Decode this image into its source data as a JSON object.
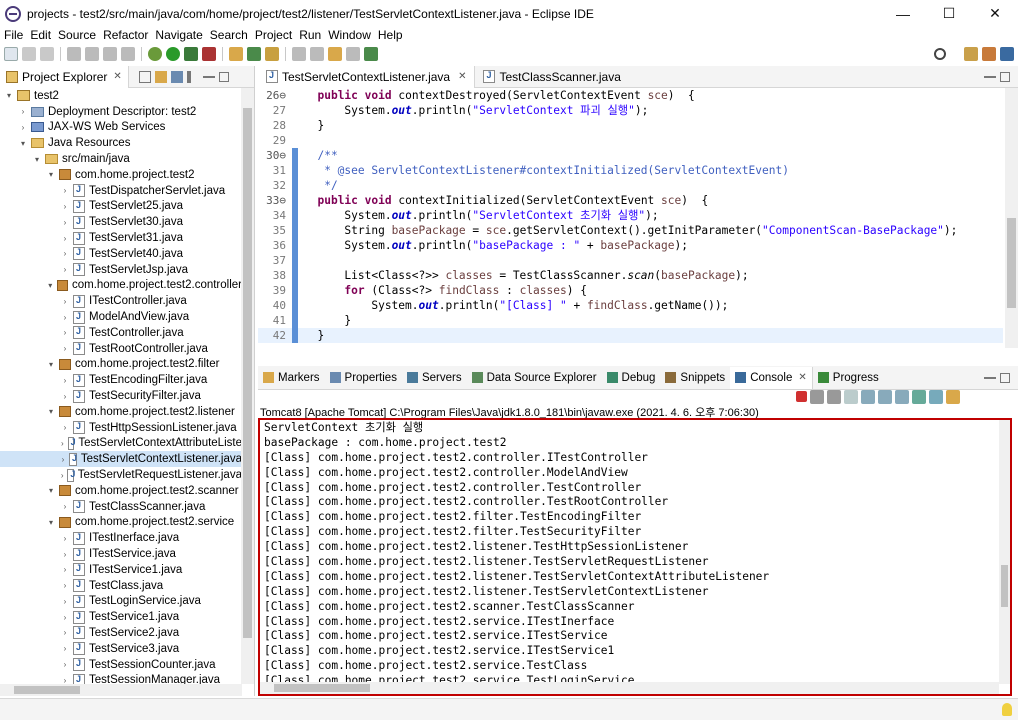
{
  "window": {
    "title": "projects - test2/src/main/java/com/home/project/test2/listener/TestServletContextListener.java - Eclipse IDE",
    "minimize": "—",
    "maximize": "☐",
    "close": "✕"
  },
  "menu": [
    "File",
    "Edit",
    "Source",
    "Refactor",
    "Navigate",
    "Search",
    "Project",
    "Run",
    "Window",
    "Help"
  ],
  "explorer": {
    "tab_label": "Project Explorer",
    "tree": [
      {
        "label": "test2",
        "depth": 0,
        "type": "project",
        "open": true
      },
      {
        "label": "Deployment Descriptor: test2",
        "depth": 1,
        "type": "dd",
        "open": false
      },
      {
        "label": "JAX-WS Web Services",
        "depth": 1,
        "type": "ws",
        "open": false
      },
      {
        "label": "Java Resources",
        "depth": 1,
        "type": "folder",
        "open": true
      },
      {
        "label": "src/main/java",
        "depth": 2,
        "type": "folder",
        "open": true
      },
      {
        "label": "com.home.project.test2",
        "depth": 3,
        "type": "pkg",
        "open": true
      },
      {
        "label": "TestDispatcherServlet.java",
        "depth": 4,
        "type": "java"
      },
      {
        "label": "TestServlet25.java",
        "depth": 4,
        "type": "java"
      },
      {
        "label": "TestServlet30.java",
        "depth": 4,
        "type": "java"
      },
      {
        "label": "TestServlet31.java",
        "depth": 4,
        "type": "java"
      },
      {
        "label": "TestServlet40.java",
        "depth": 4,
        "type": "java"
      },
      {
        "label": "TestServletJsp.java",
        "depth": 4,
        "type": "java"
      },
      {
        "label": "com.home.project.test2.controller",
        "depth": 3,
        "type": "pkg",
        "open": true
      },
      {
        "label": "ITestController.java",
        "depth": 4,
        "type": "java"
      },
      {
        "label": "ModelAndView.java",
        "depth": 4,
        "type": "java"
      },
      {
        "label": "TestController.java",
        "depth": 4,
        "type": "java"
      },
      {
        "label": "TestRootController.java",
        "depth": 4,
        "type": "java"
      },
      {
        "label": "com.home.project.test2.filter",
        "depth": 3,
        "type": "pkg",
        "open": true
      },
      {
        "label": "TestEncodingFilter.java",
        "depth": 4,
        "type": "java"
      },
      {
        "label": "TestSecurityFilter.java",
        "depth": 4,
        "type": "java"
      },
      {
        "label": "com.home.project.test2.listener",
        "depth": 3,
        "type": "pkg",
        "open": true
      },
      {
        "label": "TestHttpSessionListener.java",
        "depth": 4,
        "type": "java"
      },
      {
        "label": "TestServletContextAttributeListe",
        "depth": 4,
        "type": "java"
      },
      {
        "label": "TestServletContextListener.java",
        "depth": 4,
        "type": "java",
        "selected": true
      },
      {
        "label": "TestServletRequestListener.java",
        "depth": 4,
        "type": "java"
      },
      {
        "label": "com.home.project.test2.scanner",
        "depth": 3,
        "type": "pkg",
        "open": true
      },
      {
        "label": "TestClassScanner.java",
        "depth": 4,
        "type": "java"
      },
      {
        "label": "com.home.project.test2.service",
        "depth": 3,
        "type": "pkg",
        "open": true
      },
      {
        "label": "ITestInerface.java",
        "depth": 4,
        "type": "java"
      },
      {
        "label": "ITestService.java",
        "depth": 4,
        "type": "java"
      },
      {
        "label": "ITestService1.java",
        "depth": 4,
        "type": "java"
      },
      {
        "label": "TestClass.java",
        "depth": 4,
        "type": "java"
      },
      {
        "label": "TestLoginService.java",
        "depth": 4,
        "type": "java"
      },
      {
        "label": "TestService1.java",
        "depth": 4,
        "type": "java"
      },
      {
        "label": "TestService2.java",
        "depth": 4,
        "type": "java"
      },
      {
        "label": "TestService3.java",
        "depth": 4,
        "type": "java"
      },
      {
        "label": "TestSessionCounter.java",
        "depth": 4,
        "type": "java"
      },
      {
        "label": "TestSessionManager.java",
        "depth": 4,
        "type": "java"
      }
    ]
  },
  "editor": {
    "tabs": [
      {
        "label": "TestServletContextListener.java",
        "active": true
      },
      {
        "label": "TestClassScanner.java",
        "active": false
      }
    ],
    "lines": [
      {
        "n": "26",
        "mark": "⊖",
        "tokens": [
          [
            "  ",
            ""
          ],
          [
            "public",
            "kw"
          ],
          [
            " ",
            ""
          ],
          [
            "void",
            "kw"
          ],
          [
            " contextDestroyed(ServletContextEvent ",
            ""
          ],
          [
            "sce",
            "var"
          ],
          [
            ")  {",
            ""
          ]
        ]
      },
      {
        "n": "27",
        "tokens": [
          [
            "      System.",
            ""
          ],
          [
            "out",
            "fld"
          ],
          [
            ".println(",
            ""
          ],
          [
            "\"ServletContext 파괴 실행\"",
            "str"
          ],
          [
            ");",
            ""
          ]
        ]
      },
      {
        "n": "28",
        "tokens": [
          [
            "  }",
            ""
          ]
        ]
      },
      {
        "n": "29",
        "tokens": []
      },
      {
        "n": "30",
        "mark": "⊖",
        "gut": true,
        "tokens": [
          [
            "  /**",
            "cmt"
          ]
        ]
      },
      {
        "n": "31",
        "gut": true,
        "tokens": [
          [
            "   * @see ServletContextListener#contextInitialized(ServletContextEvent)",
            "cmt"
          ]
        ]
      },
      {
        "n": "32",
        "gut": true,
        "tokens": [
          [
            "   */",
            "cmt"
          ]
        ]
      },
      {
        "n": "33",
        "mark": "⊖",
        "gut": true,
        "tokens": [
          [
            "  ",
            ""
          ],
          [
            "public",
            "kw"
          ],
          [
            " ",
            ""
          ],
          [
            "void",
            "kw"
          ],
          [
            " contextInitialized(ServletContextEvent ",
            ""
          ],
          [
            "sce",
            "var"
          ],
          [
            ")  {",
            ""
          ]
        ]
      },
      {
        "n": "34",
        "gut": true,
        "tokens": [
          [
            "      System.",
            ""
          ],
          [
            "out",
            "fld"
          ],
          [
            ".println(",
            ""
          ],
          [
            "\"ServletContext 초기화 실행\"",
            "str"
          ],
          [
            ");",
            ""
          ]
        ]
      },
      {
        "n": "35",
        "gut": true,
        "tokens": [
          [
            "      String ",
            ""
          ],
          [
            "basePackage",
            "var"
          ],
          [
            " = ",
            ""
          ],
          [
            "sce",
            "var"
          ],
          [
            ".getServletContext().getInitParameter(",
            ""
          ],
          [
            "\"ComponentScan-BasePackage\"",
            "str"
          ],
          [
            ");",
            ""
          ]
        ]
      },
      {
        "n": "36",
        "gut": true,
        "tokens": [
          [
            "      System.",
            ""
          ],
          [
            "out",
            "fld"
          ],
          [
            ".println(",
            ""
          ],
          [
            "\"basePackage : \"",
            "str"
          ],
          [
            " + ",
            ""
          ],
          [
            "basePackage",
            "var"
          ],
          [
            ");",
            ""
          ]
        ]
      },
      {
        "n": "37",
        "gut": true,
        "tokens": []
      },
      {
        "n": "38",
        "gut": true,
        "tokens": [
          [
            "      List<Class<?>> ",
            ""
          ],
          [
            "classes",
            "var"
          ],
          [
            " = TestClassScanner.",
            ""
          ],
          [
            "scan",
            "ital"
          ],
          [
            "(",
            ""
          ],
          [
            "basePackage",
            "var"
          ],
          [
            ");",
            ""
          ]
        ]
      },
      {
        "n": "39",
        "gut": true,
        "tokens": [
          [
            "      ",
            ""
          ],
          [
            "for",
            "kw"
          ],
          [
            " (Class<?> ",
            ""
          ],
          [
            "findClass",
            "var"
          ],
          [
            " : ",
            ""
          ],
          [
            "classes",
            "var"
          ],
          [
            ") {",
            ""
          ]
        ]
      },
      {
        "n": "40",
        "gut": true,
        "tokens": [
          [
            "          System.",
            ""
          ],
          [
            "out",
            "fld"
          ],
          [
            ".println(",
            ""
          ],
          [
            "\"[Class] \"",
            "str"
          ],
          [
            " + ",
            ""
          ],
          [
            "findClass",
            "var"
          ],
          [
            ".getName());",
            ""
          ]
        ]
      },
      {
        "n": "41",
        "gut": true,
        "tokens": [
          [
            "      }",
            ""
          ]
        ]
      },
      {
        "n": "42",
        "gut": true,
        "cur": true,
        "tokens": [
          [
            "  }",
            ""
          ]
        ]
      }
    ]
  },
  "console": {
    "tabs": [
      "Markers",
      "Properties",
      "Servers",
      "Data Source Explorer",
      "Debug",
      "Snippets",
      "Console",
      "Progress"
    ],
    "process": "Tomcat8 [Apache Tomcat] C:\\Program Files\\Java\\jdk1.8.0_181\\bin\\javaw.exe  (2021. 4. 6. 오후 7:06:30)",
    "output": [
      "ServletContext 초기화 실행",
      "basePackage : com.home.project.test2",
      "[Class] com.home.project.test2.controller.ITestController",
      "[Class] com.home.project.test2.controller.ModelAndView",
      "[Class] com.home.project.test2.controller.TestController",
      "[Class] com.home.project.test2.controller.TestRootController",
      "[Class] com.home.project.test2.filter.TestEncodingFilter",
      "[Class] com.home.project.test2.filter.TestSecurityFilter",
      "[Class] com.home.project.test2.listener.TestHttpSessionListener",
      "[Class] com.home.project.test2.listener.TestServletRequestListener",
      "[Class] com.home.project.test2.listener.TestServletContextAttributeListener",
      "[Class] com.home.project.test2.listener.TestServletContextListener",
      "[Class] com.home.project.test2.scanner.TestClassScanner",
      "[Class] com.home.project.test2.service.ITestInerface",
      "[Class] com.home.project.test2.service.ITestService",
      "[Class] com.home.project.test2.service.ITestService1",
      "[Class] com.home.project.test2.service.TestClass",
      "[Class] com.home.project.test2.service.TestLoginService"
    ]
  },
  "colors": {
    "highlight_border": "#c00000",
    "selection": "#cfe3f7",
    "keyword": "#7f0055",
    "string": "#2a00ff",
    "comment": "#3f5fbf"
  }
}
